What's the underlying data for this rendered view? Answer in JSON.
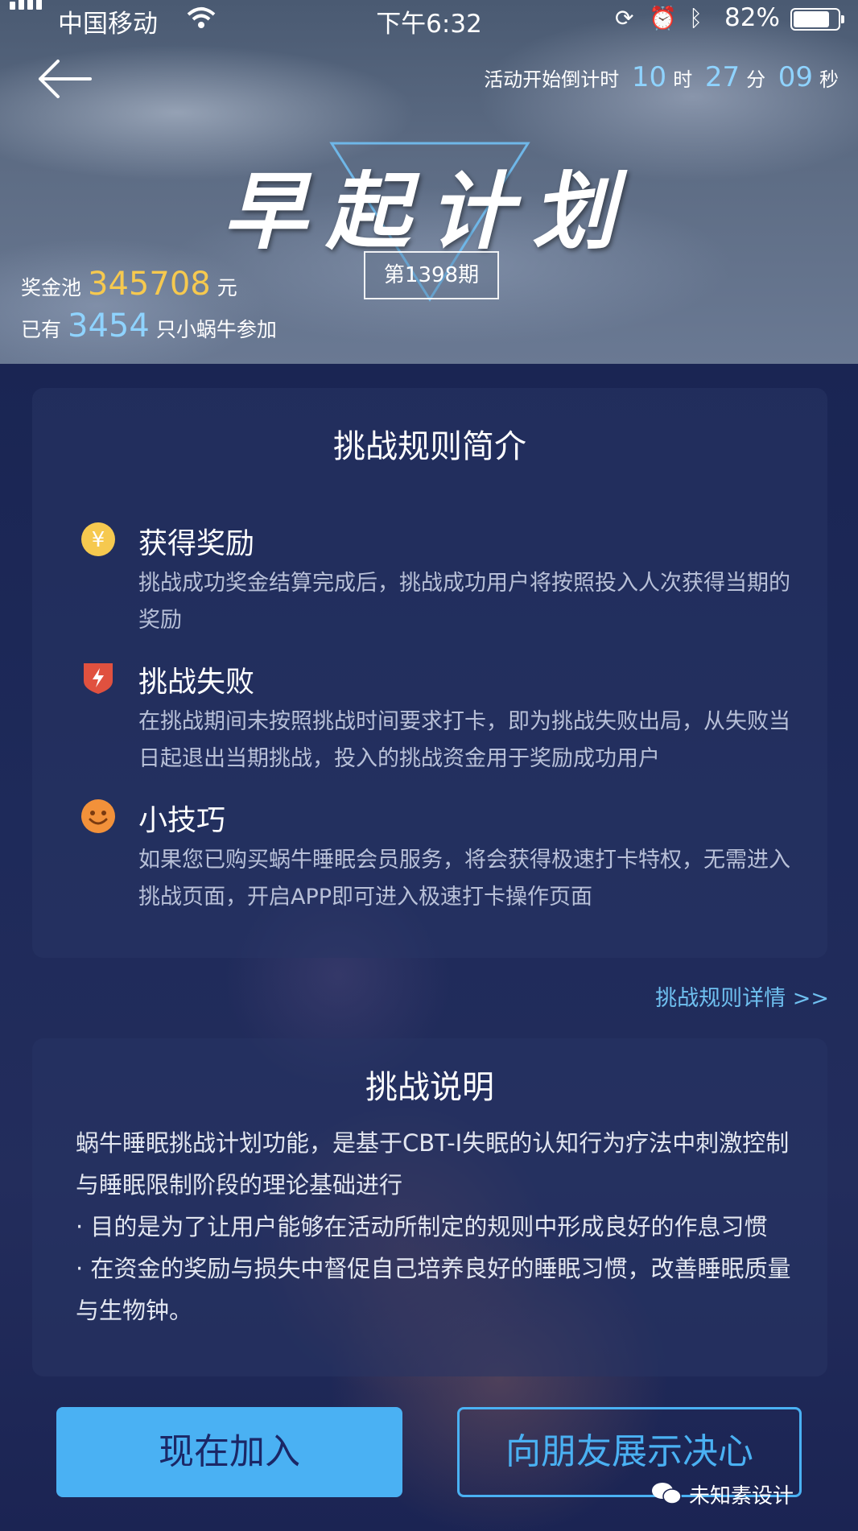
{
  "status_bar": {
    "carrier": "中国移动",
    "time": "下午6:32",
    "battery": "82%"
  },
  "header": {
    "countdown_label": "活动开始倒计时",
    "hours": "10",
    "hours_unit": "时",
    "minutes": "27",
    "minutes_unit": "分",
    "seconds": "09",
    "seconds_unit": "秒",
    "title": "早起计划",
    "issue": "第1398期",
    "pool_label": "奖金池",
    "pool_value": "345708",
    "pool_unit": "元",
    "joined_prefix": "已有",
    "joined_value": "3454",
    "joined_suffix": "只小蜗牛参加"
  },
  "rules_card": {
    "title": "挑战规则简介",
    "items": [
      {
        "icon": "yuan-coin-icon",
        "title": "获得奖励",
        "desc": "挑战成功奖金结算完成后，挑战成功用户将按照投入人次获得当期的奖励"
      },
      {
        "icon": "shield-lightning-icon",
        "title": "挑战失败",
        "desc": "在挑战期间未按照挑战时间要求打卡，即为挑战失败出局，从失败当日起退出当期挑战，投入的挑战资金用于奖励成功用户"
      },
      {
        "icon": "smiley-icon",
        "title": "小技巧",
        "desc": "如果您已购买蜗牛睡眠会员服务，将会获得极速打卡特权，无需进入挑战页面，开启APP即可进入极速打卡操作页面"
      }
    ],
    "detail_link": "挑战规则详情 >>"
  },
  "explain_card": {
    "title": "挑战说明",
    "body": "蜗牛睡眠挑战计划功能，是基于CBT-I失眠的认知行为疗法中刺激控制与睡眠限制阶段的理论基础进行",
    "bullet1": "·   目的是为了让用户能够在活动所制定的规则中形成良好的作息习惯",
    "bullet2": "·   在资金的奖励与损失中督促自己培养良好的睡眠习惯，改善睡眠质量与生物钟。"
  },
  "actions": {
    "join": "现在加入",
    "share": "向朋友展示决心"
  },
  "watermark": "未知素设计",
  "colors": {
    "accent_blue": "#4ab1f3",
    "gold": "#f6c94f",
    "light_blue": "#8fd3ff"
  }
}
